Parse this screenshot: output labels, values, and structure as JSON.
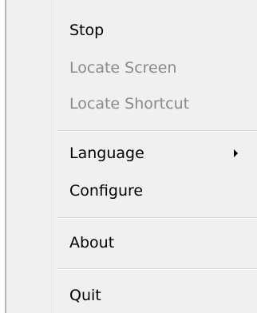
{
  "menu": {
    "items": [
      {
        "label": "Stop",
        "enabled": true
      },
      {
        "label": "Locate Screen",
        "enabled": false
      },
      {
        "label": "Locate Shortcut",
        "enabled": false
      },
      {
        "label": "Language",
        "enabled": true,
        "has_submenu": true
      },
      {
        "label": "Configure",
        "enabled": true
      },
      {
        "label": "About",
        "enabled": true
      },
      {
        "label": "Quit",
        "enabled": true
      }
    ]
  },
  "icons": {
    "submenu_arrow": "chevron-right-icon"
  },
  "colors": {
    "menu_bg": "#f0f0f0",
    "enabled_text": "#000000",
    "disabled_text": "#8a8a8a"
  }
}
